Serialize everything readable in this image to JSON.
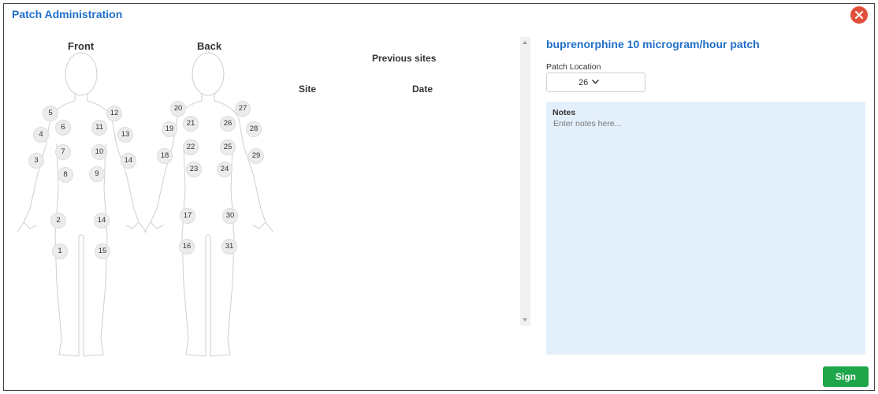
{
  "dialog": {
    "title": "Patch Administration"
  },
  "body_map": {
    "front_label": "Front",
    "back_label": "Back",
    "front_sites": [
      "1",
      "2",
      "3",
      "4",
      "5",
      "6",
      "7",
      "8",
      "9",
      "10",
      "11",
      "12",
      "13",
      "14",
      "14",
      "15"
    ],
    "back_sites": [
      "16",
      "17",
      "18",
      "19",
      "20",
      "21",
      "22",
      "23",
      "24",
      "25",
      "26",
      "27",
      "28",
      "29",
      "30",
      "31"
    ]
  },
  "previous_sites": {
    "title": "Previous sites",
    "columns": [
      "Site",
      "Date"
    ],
    "rows": []
  },
  "medication": {
    "name": "buprenorphine 10 microgram/hour patch"
  },
  "patch_location": {
    "label": "Patch Location",
    "value": "26"
  },
  "notes": {
    "label": "Notes",
    "placeholder": "Enter notes here..."
  },
  "actions": {
    "sign_label": "Sign"
  },
  "colors": {
    "accent": "#1f6fc8",
    "close": "#e0503a",
    "sign": "#1fa64a",
    "notes_bg": "#e4effc"
  }
}
